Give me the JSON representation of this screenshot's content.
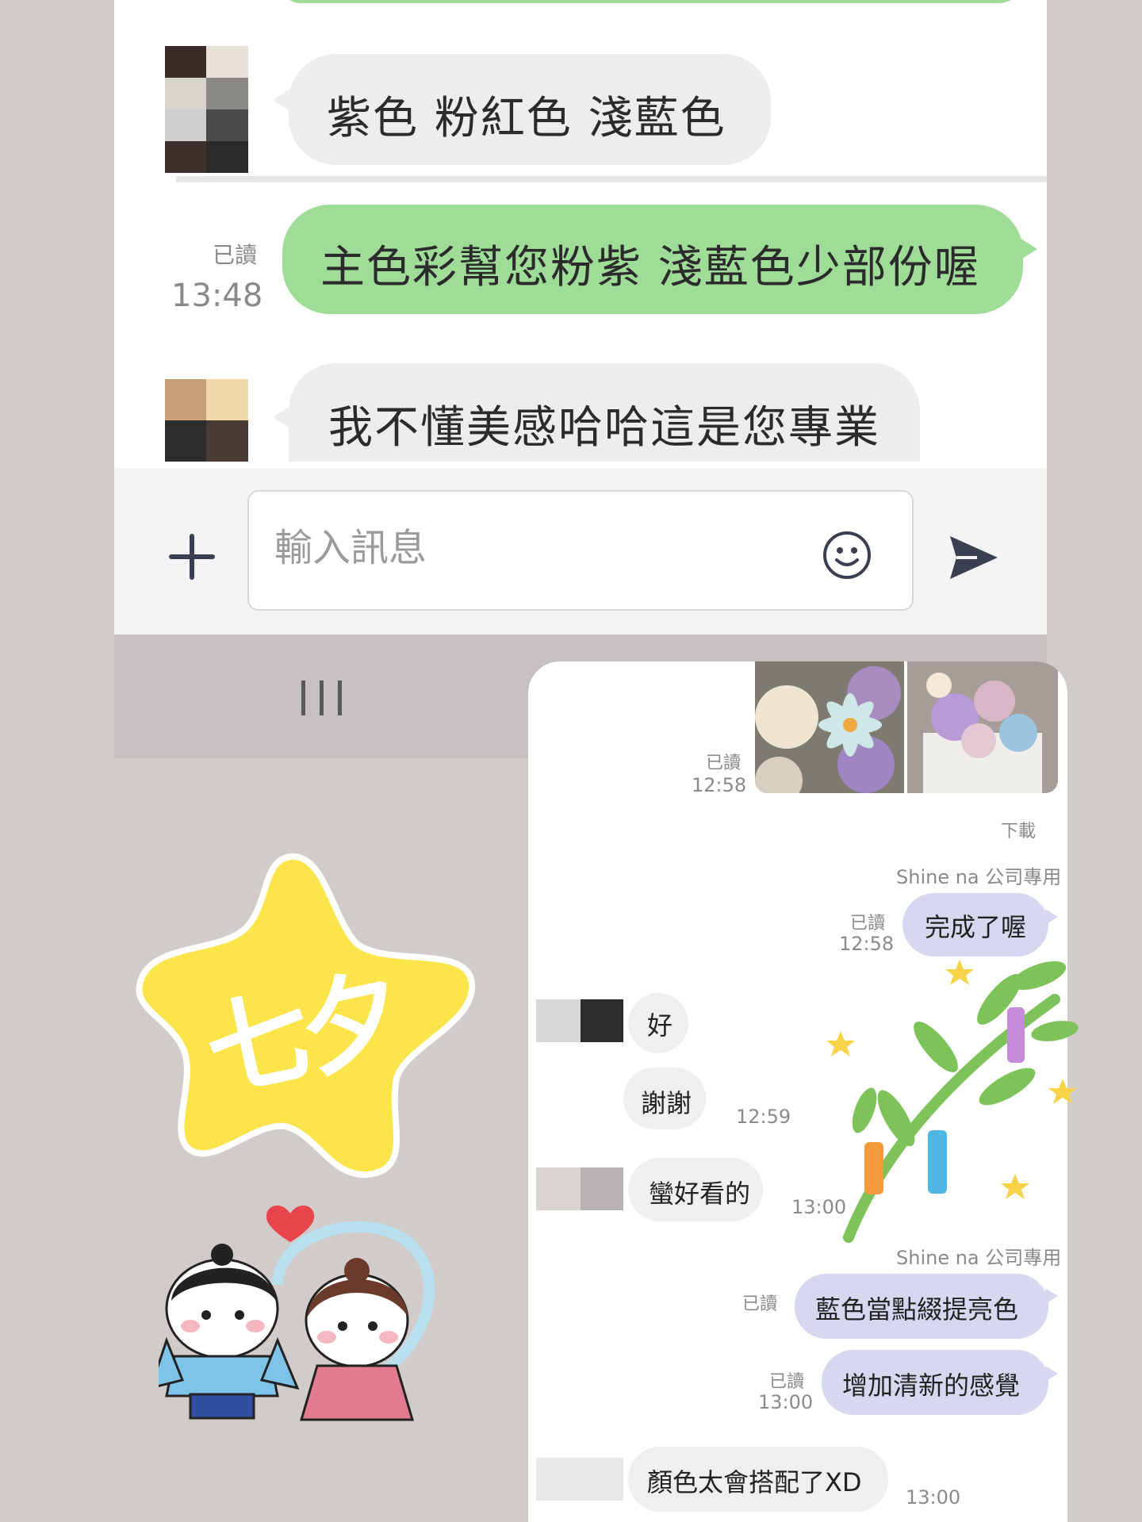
{
  "upper_chat": {
    "messages": [
      {
        "side": "left",
        "text": "紫色 粉紅色 淺藍色"
      },
      {
        "side": "right",
        "read": "已讀",
        "time": "13:48",
        "text": "主色彩幫您粉紫 淺藍色少部份喔"
      },
      {
        "side": "left",
        "text": "我不懂美感哈哈這是您專業"
      }
    ],
    "input": {
      "placeholder": "輸入訊息"
    },
    "icons": {
      "plus": "plus-icon",
      "emoji": "emoji-icon",
      "send": "send-icon",
      "nav": "recent-apps-icon"
    }
  },
  "lower_chat": {
    "photo_read": "已讀",
    "photo_time": "12:58",
    "download": "下載",
    "sender_1": "Shine na 公司專用",
    "msg_done": {
      "read": "已讀",
      "time": "12:58",
      "text": "完成了喔"
    },
    "msg_ok": {
      "text": "好"
    },
    "msg_thanks": {
      "text": "謝謝",
      "time": "12:59"
    },
    "msg_pretty": {
      "text": "蠻好看的",
      "time": "13:00"
    },
    "sender_2": "Shine na 公司專用",
    "msg_blue": {
      "read": "已讀",
      "text": "藍色當點綴提亮色"
    },
    "msg_fresh": {
      "read": "已讀",
      "time": "13:00",
      "text": "增加清新的感覺"
    },
    "msg_xd": {
      "text": "顏色太會搭配了XD",
      "time": "13:00"
    }
  },
  "stickers": {
    "star_text": "七夕",
    "colors": {
      "star": "#fbe54a",
      "heart": "#e8454d",
      "boy_robe": "#7ec3e8",
      "girl_robe": "#e37b90",
      "bamboo": "#7dc35a"
    }
  },
  "colors": {
    "green_bubble": "#9fdc98",
    "gray_bubble": "#ededed",
    "lavender_bubble": "#d6d8ef",
    "background": "#d1cbca"
  }
}
